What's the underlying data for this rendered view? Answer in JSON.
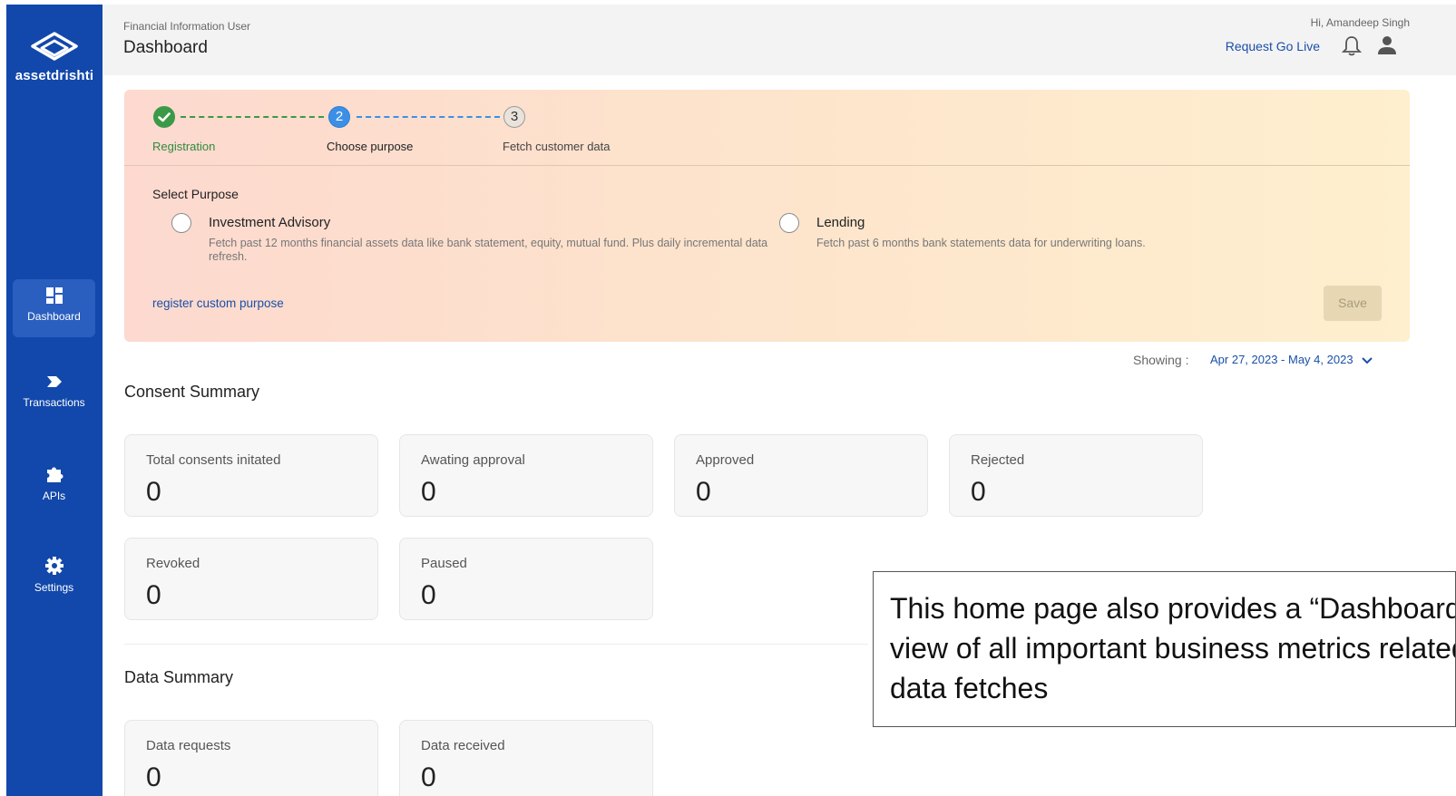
{
  "sidebar": {
    "brand": "assetdrishti",
    "items": [
      {
        "label": "Dashboard",
        "icon": "dashboard-icon",
        "active": true
      },
      {
        "label": "Transactions",
        "icon": "transactions-icon",
        "active": false
      },
      {
        "label": "APIs",
        "icon": "puzzle-icon",
        "active": false
      },
      {
        "label": "Settings",
        "icon": "gear-icon",
        "active": false
      }
    ],
    "color": "#1248ab"
  },
  "header": {
    "breadcrumb": "Financial Information User",
    "title": "Dashboard",
    "greeting": "Hi, Amandeep Singh",
    "go_live_label": "Request Go Live",
    "icons": [
      "bell-icon",
      "user-icon"
    ]
  },
  "onboarding": {
    "steps": [
      {
        "number": "1",
        "label": "Registration",
        "state": "done"
      },
      {
        "number": "2",
        "label": "Choose purpose",
        "state": "active"
      },
      {
        "number": "3",
        "label": "Fetch customer data",
        "state": "todo"
      }
    ],
    "select_title": "Select Purpose",
    "options": [
      {
        "title": "Investment Advisory",
        "description": "Fetch past 12 months financial assets data like bank statement, equity, mutual fund. Plus daily incremental data refresh.",
        "selected": false
      },
      {
        "title": "Lending",
        "description": "Fetch past 6 months bank statements data for underwriting loans.",
        "selected": false
      }
    ],
    "custom_link": "register custom purpose",
    "save_label": "Save"
  },
  "filter": {
    "showing_label": "Showing :",
    "date_range": "Apr 27, 2023 - May 4, 2023"
  },
  "consent_summary": {
    "title": "Consent Summary",
    "cards": [
      {
        "label": "Total consents initated",
        "value": "0"
      },
      {
        "label": "Awating approval",
        "value": "0"
      },
      {
        "label": "Approved",
        "value": "0"
      },
      {
        "label": "Rejected",
        "value": "0"
      },
      {
        "label": "Revoked",
        "value": "0"
      },
      {
        "label": "Paused",
        "value": "0"
      }
    ]
  },
  "data_summary": {
    "title": "Data Summary",
    "cards": [
      {
        "label": "Data requests",
        "value": "0"
      },
      {
        "label": "Data received",
        "value": "0"
      }
    ]
  },
  "callout": {
    "text": "This home page also provides a “Dashboard” view of all important business metrics related to data fetches"
  }
}
